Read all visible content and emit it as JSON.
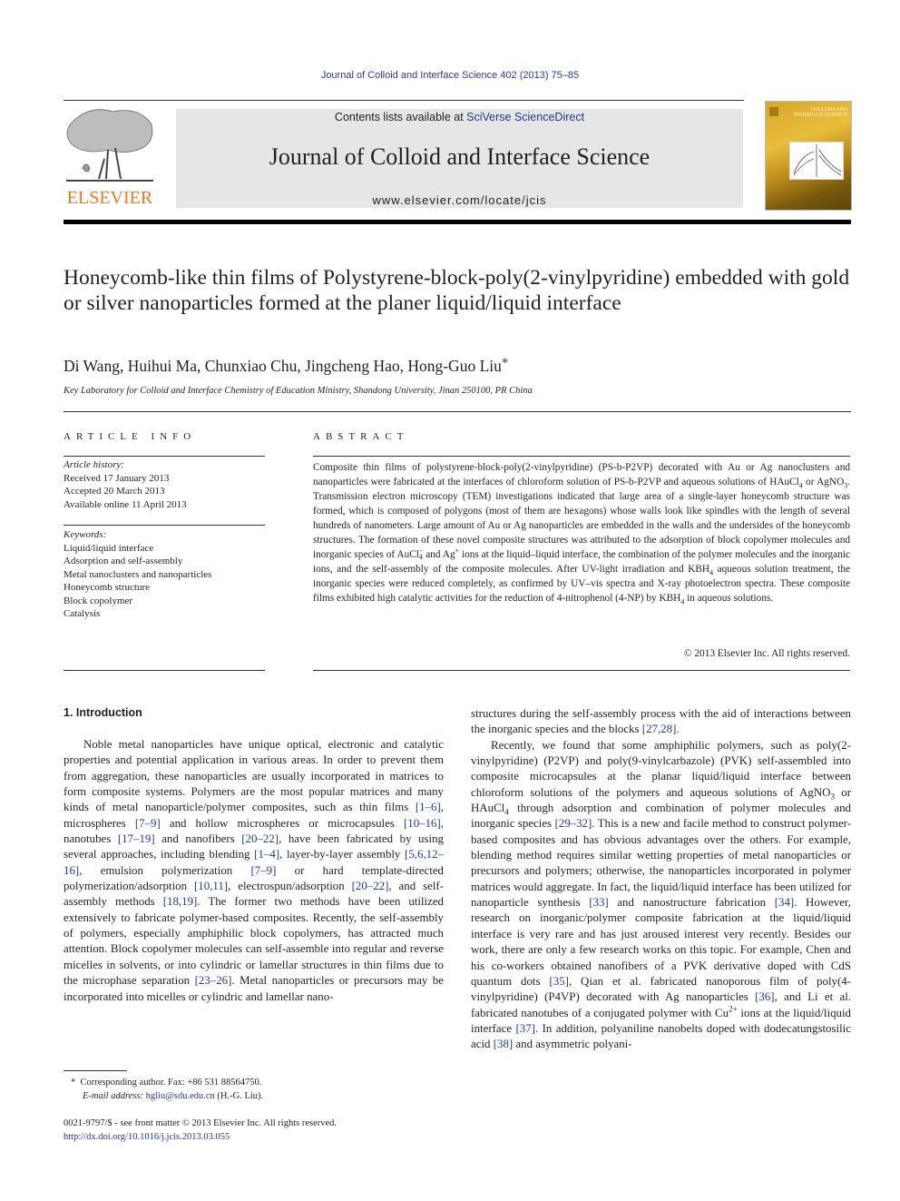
{
  "running_head": "Journal of Colloid and Interface Science 402 (2013) 75–85",
  "masthead": {
    "publisher_logo": "ELSEVIER",
    "contents_prefix": "Contents lists available at ",
    "contents_link": "SciVerse ScienceDirect",
    "journal_title": "Journal of Colloid and Interface Science",
    "journal_url": "www.elsevier.com/locate/jcis",
    "cover_title": "COLLOID AND INTERFACE SCIENCE",
    "colors": {
      "elsevier_orange": "#f07a1a",
      "link_blue": "#2b3a8c",
      "banner_gray": "#e6e6e6"
    }
  },
  "article": {
    "title": "Honeycomb-like thin films of Polystyrene-block-poly(2-vinylpyridine) embedded with gold or silver nanoparticles formed at the planer liquid/liquid interface",
    "authors": "Di Wang, Huihui Ma, Chunxiao Chu, Jingcheng Hao, Hong-Guo Liu",
    "corresponding_mark": "*",
    "affiliation": "Key Laboratory for Colloid and Interface Chemistry of Education Ministry, Shandong University, Jinan 250100, PR China"
  },
  "article_info": {
    "heading": "ARTICLE INFO",
    "history_label": "Article history:",
    "history": [
      "Received 17 January 2013",
      "Accepted 20 March 2013",
      "Available online 11 April 2013"
    ],
    "keywords_label": "Keywords:",
    "keywords": [
      "Liquid/liquid interface",
      "Adsorption and self-assembly",
      "Metal nanoclusters and nanoparticles",
      "Honeycomb structure",
      "Block copolymer",
      "Catalysis"
    ]
  },
  "abstract": {
    "heading": "ABSTRACT",
    "p1": "Composite thin films of polystyrene-block-poly(2-vinylpyridine) (PS-b-P2VP) decorated with Au or Ag nanoclusters and nanoparticles were fabricated at the interfaces of chloroform solution of PS-b-P2VP and aqueous solutions of HAuCl",
    "s1": "4",
    "p2": " or AgNO",
    "s2": "3",
    "p3": ". Transmission electron microscopy (TEM) investigations indicated that large area of a single-layer honeycomb structure was formed, which is composed of polygons (most of them are hexagons) whose walls look like spindles with the length of several hundreds of nanometers. Large amount of Au or Ag nanoparticles are embedded in the walls and the undersides of the honeycomb structures. The formation of these novel composite structures was attributed to the adsorption of block copolymer molecules and inorganic species of AuCl",
    "s3sub": "4",
    "s3sup": "−",
    "p4": " and Ag",
    "s4sup": "+",
    "p5": " ions at the liquid–liquid interface, the combination of the polymer molecules and the inorganic ions, and the self-assembly of the composite molecules. After UV-light irradiation and KBH",
    "s5": "4",
    "p6": " aqueous solution treatment, the inorganic species were reduced completely, as confirmed by UV–vis spectra and X-ray photoelectron spectra. These composite films exhibited high catalytic activities for the reduction of 4-nitrophenol (4-NP) by KBH",
    "s6": "4",
    "p7": " in aqueous solutions.",
    "copyright": "© 2013 Elsevier Inc. All rights reserved."
  },
  "intro": {
    "heading": "1. Introduction",
    "left": {
      "t1": "Noble metal nanoparticles have unique optical, electronic and catalytic properties and potential application in various areas. In order to prevent them from aggregation, these nanoparticles are usually incorporated in matrices to form composite systems. Polymers are the most popular matrices and many kinds of metal nanoparticle/polymer composites, such as thin films ",
      "r1": "[1–6]",
      "t2": ", microspheres ",
      "r2": "[7–9]",
      "t3": " and hollow microspheres or microcapsules ",
      "r3": "[10–16]",
      "t4": ", nanotubes ",
      "r4": "[17–19]",
      "t5": " and nanofibers ",
      "r5": "[20–22]",
      "t6": ", have been fabricated by using several approaches, including blending ",
      "r6": "[1–4]",
      "t7": ", layer-by-layer assembly ",
      "r7": "[5,6,12–16]",
      "t8": ", emulsion polymerization ",
      "r8": "[7–9]",
      "t9": " or hard template-directed polymerization/adsorption ",
      "r9": "[10,11]",
      "t10": ", electrospun/adsorption ",
      "r10": "[20–22]",
      "t11": ", and self-assembly methods ",
      "r11": "[18,19]",
      "t12": ". The former two methods have been utilized extensively to fabricate polymer-based composites. Recently, the self-assembly of polymers, especially amphiphilic block copolymers, has attracted much attention. Block copolymer molecules can self-assemble into regular and reverse micelles in solvents, or into cylindric or lamellar structures in thin films due to the microphase separation ",
      "r12": "[23–26]",
      "t13": ". Metal nanoparticles or precursors may be incorporated into micelles or cylindric and lamellar nano-"
    },
    "right": {
      "a1": "structures during the self-assembly process with the aid of interactions between the inorganic species and the blocks ",
      "ar1": "[27,28]",
      "a2": ".",
      "b1": "Recently, we found that some amphiphilic polymers, such as poly(2-vinylpyridine) (P2VP) and poly(9-vinylcarbazole) (PVK) self-assembled into composite microcapsules at the planar liquid/liquid interface between chloroform solutions of the polymers and aqueous solutions of AgNO",
      "bs1": "3",
      "b2": " or HAuCl",
      "bs2": "4",
      "b3": " through adsorption and combination of polymer molecules and inorganic species ",
      "br1": "[29–32]",
      "b4": ". This is a new and facile method to construct polymer-based composites and has obvious advantages over the others. For example, blending method requires similar wetting properties of metal nanoparticles or precursors and polymers; otherwise, the nanoparticles incorporated in polymer matrices would aggregate. In fact, the liquid/liquid interface has been utilized for nanoparticle synthesis ",
      "br2": "[33]",
      "b5": " and nanostructure fabrication ",
      "br3": "[34]",
      "b6": ". However, research on inorganic/polymer composite fabrication at the liquid/liquid interface is very rare and has just aroused interest very recently. Besides our work, there are only a few research works on this topic. For example, Chen and his co-workers obtained nanofibers of a PVK derivative doped with CdS quantum dots ",
      "br4": "[35]",
      "b7": ", Qian et al. fabricated nanoporous film of poly(4-vinylpyridine) (P4VP) decorated with Ag nanoparticles ",
      "br5": "[36]",
      "b8": ", and Li et al. fabricated nanotubes of a conjugated polymer with Cu",
      "bsup": "2+",
      "b9": " ions at the liquid/liquid interface ",
      "br6": "[37]",
      "b10": ". In addition, polyaniline nanobelts doped with dodecatungstosilic acid ",
      "br7": "[38]",
      "b11": " and asymmetric polyani-"
    }
  },
  "footnote": {
    "mark": "*",
    "text": "Corresponding author. Fax: +86 531 88564750.",
    "email_label": "E-mail address:",
    "email": "hgliu@sdu.edu.cn",
    "email_suffix": " (H.-G. Liu)."
  },
  "front_matter": {
    "issn_line": "0021-9797/$ - see front matter © 2013 Elsevier Inc. All rights reserved.",
    "doi": "http://dx.doi.org/10.1016/j.jcis.2013.03.055"
  }
}
